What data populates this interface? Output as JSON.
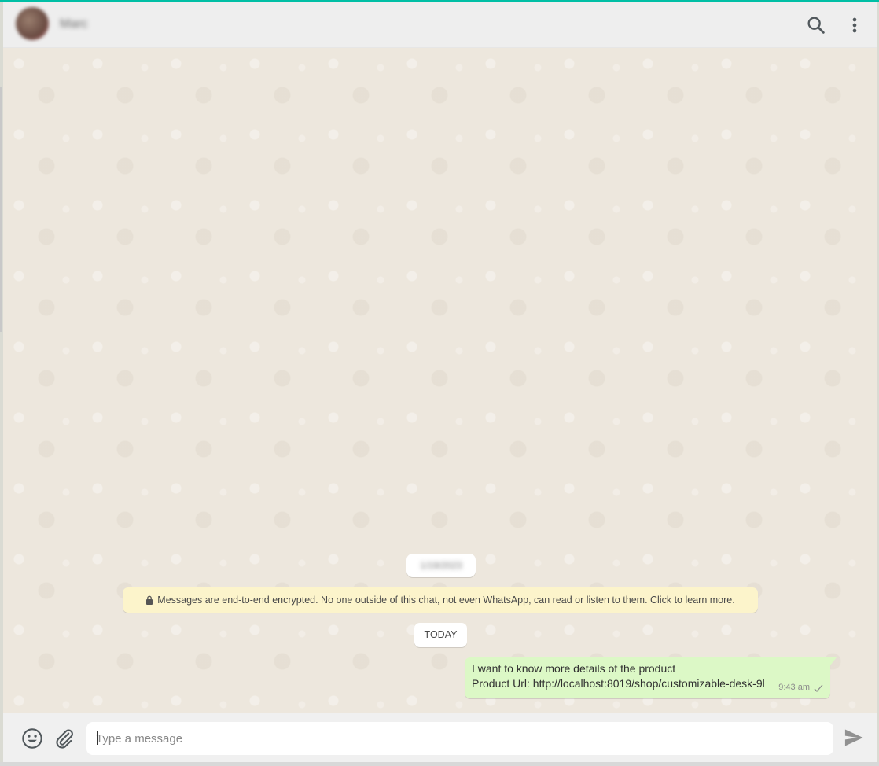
{
  "header": {
    "contact_name": "Marc",
    "search_icon": "search-icon",
    "menu_icon": "more-vertical-icon"
  },
  "chat": {
    "date_badge": "1/19/2023",
    "encryption_notice": "Messages are end-to-end encrypted. No one outside of this chat, not even WhatsApp, can read or listen to them. Click to learn more.",
    "today_label": "TODAY",
    "messages": [
      {
        "direction": "outgoing",
        "line1": "I want to know more details of the product",
        "line2": "Product Url: http://localhost:8019/shop/customizable-desk-9l",
        "time": "9:43 am",
        "status_icon": "single-check-icon"
      }
    ]
  },
  "composer": {
    "placeholder": "Type a message",
    "value": "",
    "emoji_icon": "emoji-icon",
    "attach_icon": "paperclip-icon",
    "send_icon": "send-icon"
  },
  "colors": {
    "accent": "#00bfa5",
    "outgoing_bubble": "#dcf8c6",
    "notice_bg": "#fcf4cb",
    "chat_bg": "#ede7dd"
  }
}
